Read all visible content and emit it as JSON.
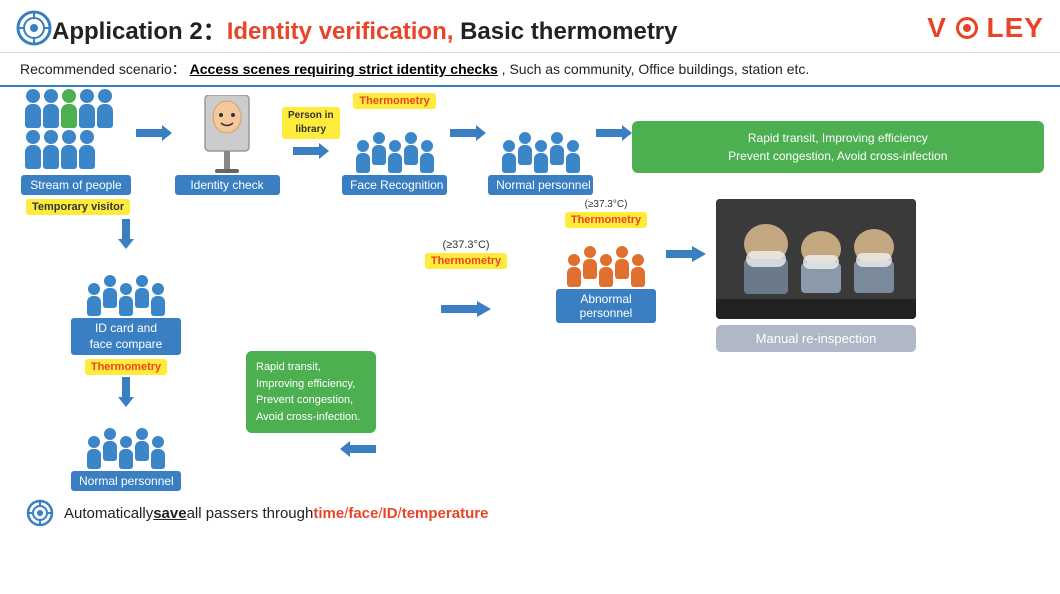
{
  "header": {
    "app_label": "Application 2：",
    "identity_label": "Identity verification,",
    "subtitle": " Basic thermometry",
    "logo": "VÖLEY",
    "icon_label": "target-icon"
  },
  "scenario": {
    "prefix": "Recommended scenario：",
    "highlight": "Access scenes requiring strict identity checks",
    "suffix": ",  Such as community, Office buildings, station etc."
  },
  "flow_top": {
    "nodes": [
      {
        "label": "Stream of people",
        "icon": "people-stream-icon"
      },
      {
        "label": "Identity check",
        "icon": "kiosk-icon"
      },
      {
        "label": "Face Recognition",
        "icon": "people-face-icon"
      },
      {
        "label": "Normal personnel",
        "icon": "people-normal-icon"
      }
    ],
    "badges": {
      "person_in_library": "Person in\nlibrary",
      "thermometry_top": "Thermometry"
    },
    "green_box": {
      "line1": "Rapid transit, Improving efficiency",
      "line2": "Prevent congestion, Avoid cross-infection"
    }
  },
  "flow_bottom": {
    "left_branch": {
      "badge": "Temporary visitor",
      "node1_label": "ID card and\nface compare",
      "thermometry_badge": "Thermometry",
      "node2_label": "Normal personnel",
      "green_box": {
        "line1": "Rapid transit,",
        "line2": "Improving efficiency,",
        "line3": "Prevent congestion,",
        "line4": "Avoid cross-infection."
      }
    },
    "right_branch": {
      "temp_badge": "(≥37.3°C)",
      "thermometry_badge": "Thermometry",
      "abnormal_label": "Abnormal\npersonnel",
      "temp_badge2": "(≥37.3°C)",
      "thermometry_badge2": "Thermometry",
      "manual_label": "Manual re-inspection"
    }
  },
  "auto_save": {
    "prefix": "Automatically ",
    "save_word": "save",
    "middle": " all passers through ",
    "time": "time",
    "slash1": " / ",
    "face": "face",
    "slash2": " / ",
    "id": "ID",
    "slash3": " / ",
    "temperature": "temperature"
  },
  "colors": {
    "blue": "#3a7fc1",
    "red": "#e8442a",
    "yellow": "#ffeb3b",
    "green": "#4caf50",
    "orange": "#e07030",
    "gray_box": "#8fa0b8"
  }
}
